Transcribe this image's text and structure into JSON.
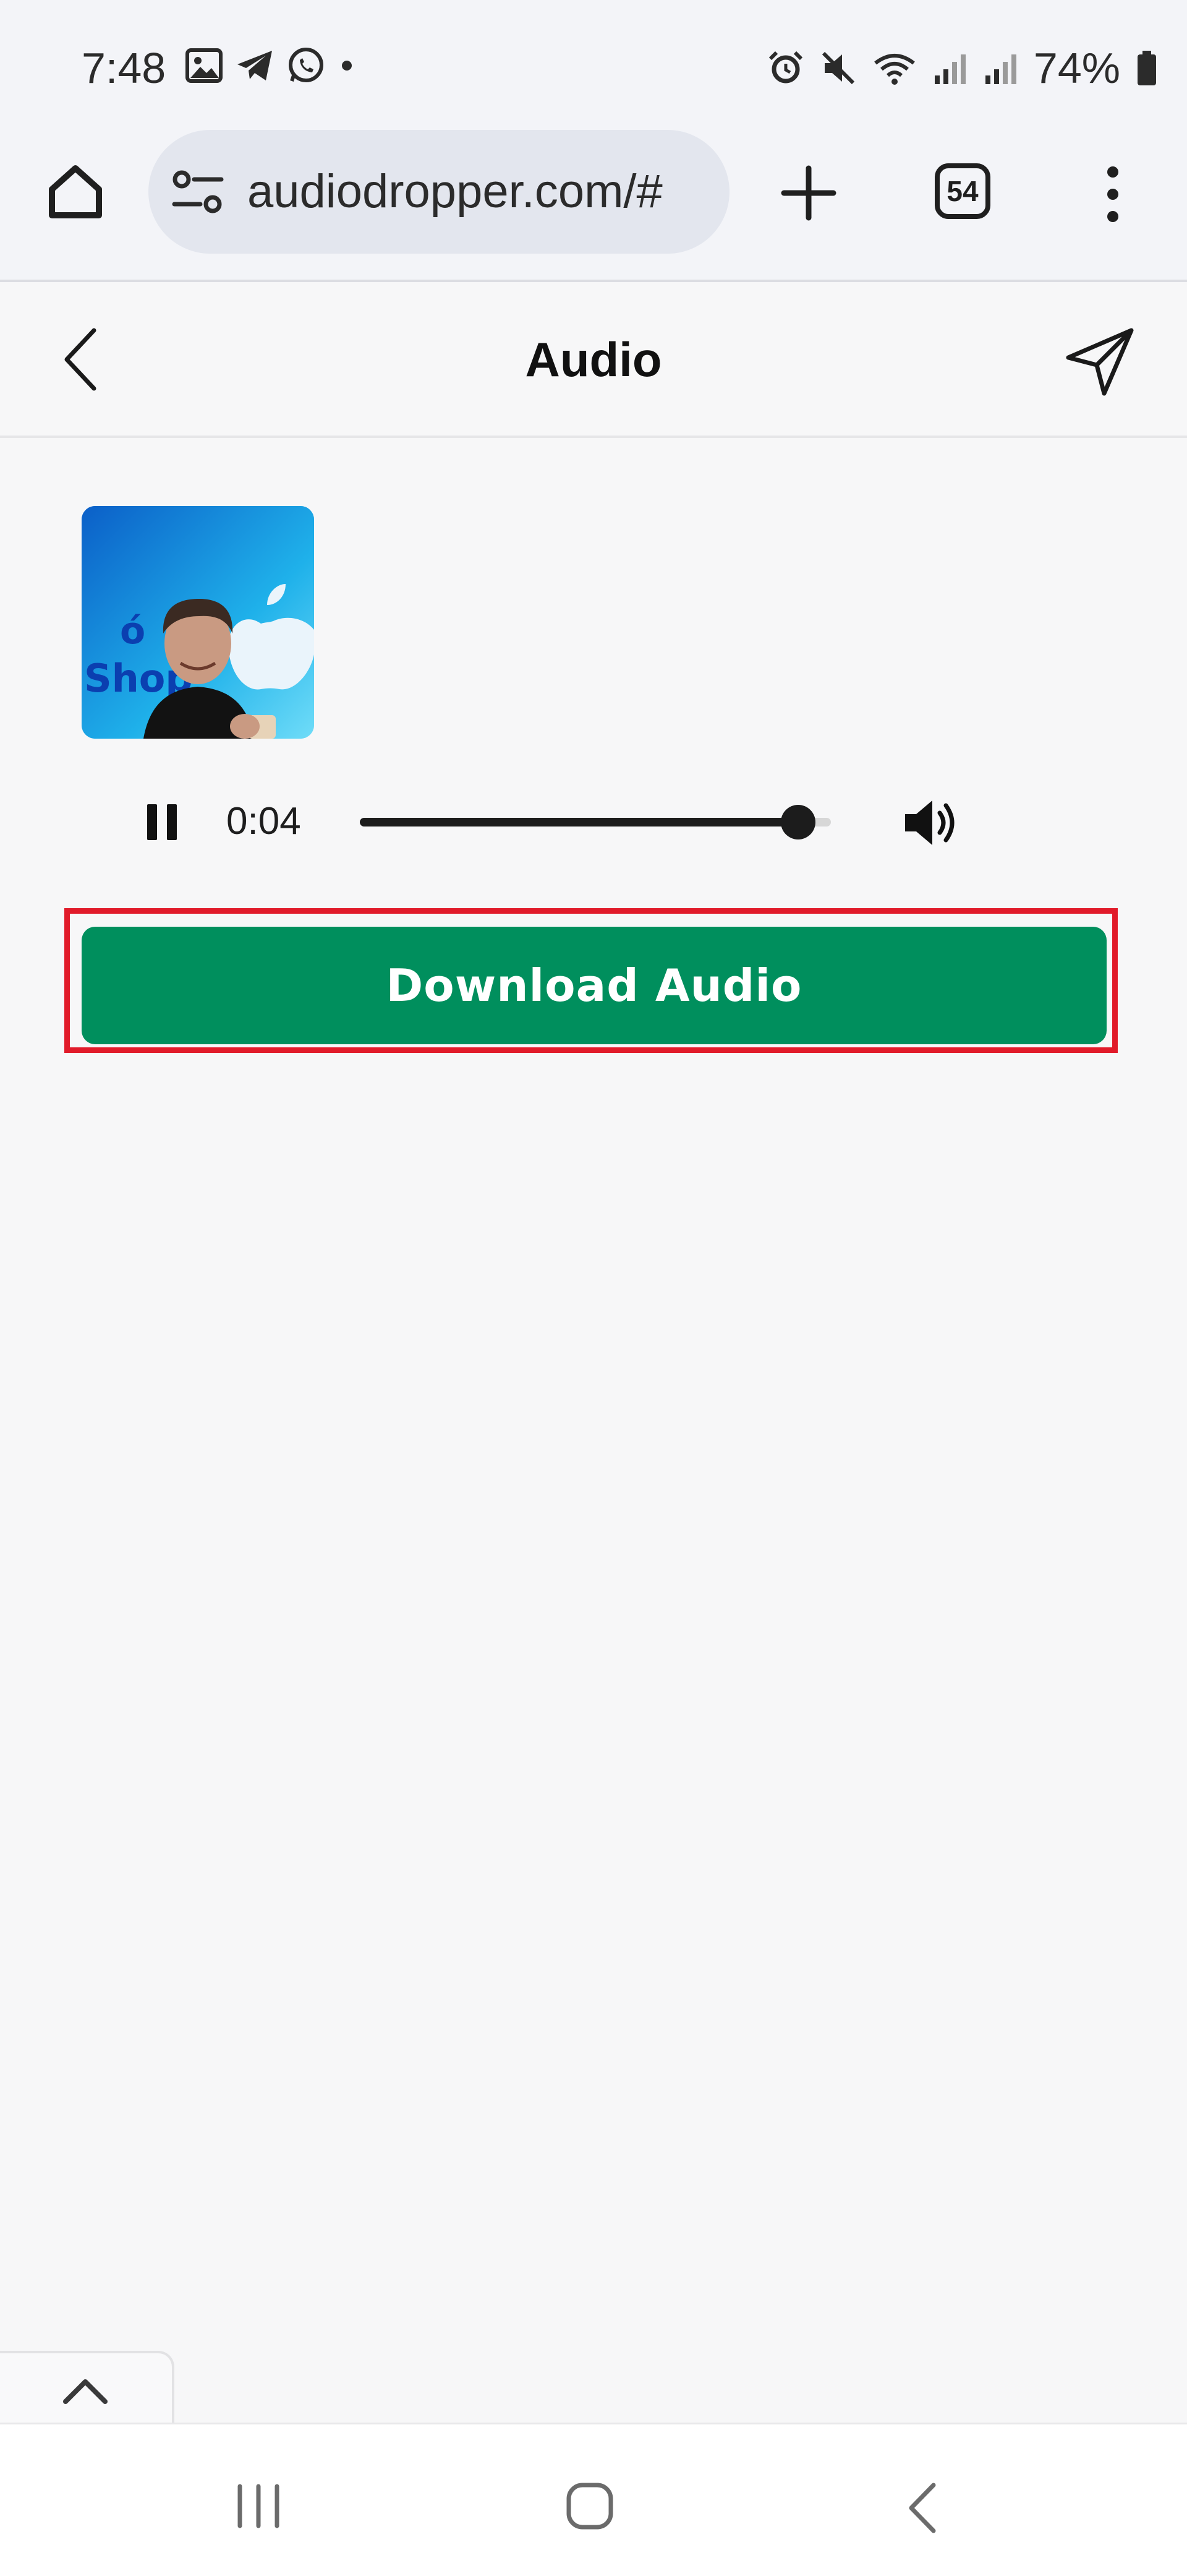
{
  "status_bar": {
    "time": "7:48",
    "battery": "74%",
    "left_icons": [
      "gallery-icon",
      "telegram-icon",
      "whatsapp-icon",
      "dot-icon"
    ],
    "right_icons": [
      "alarm-icon",
      "mute-icon",
      "wifi-icon",
      "signal-icon",
      "signal-icon",
      "battery-icon"
    ]
  },
  "browser": {
    "url": "audiodropper.com/#",
    "tab_count": "54"
  },
  "header": {
    "title": "Audio"
  },
  "player": {
    "elapsed": "0:04",
    "progress_fraction": 0.93,
    "state": "playing"
  },
  "actions": {
    "download_label": "Download Audio",
    "download_color": "#008f5d",
    "highlight_color": "#e11b2a"
  },
  "thumbnail": {
    "overlay_text": "Shop"
  }
}
